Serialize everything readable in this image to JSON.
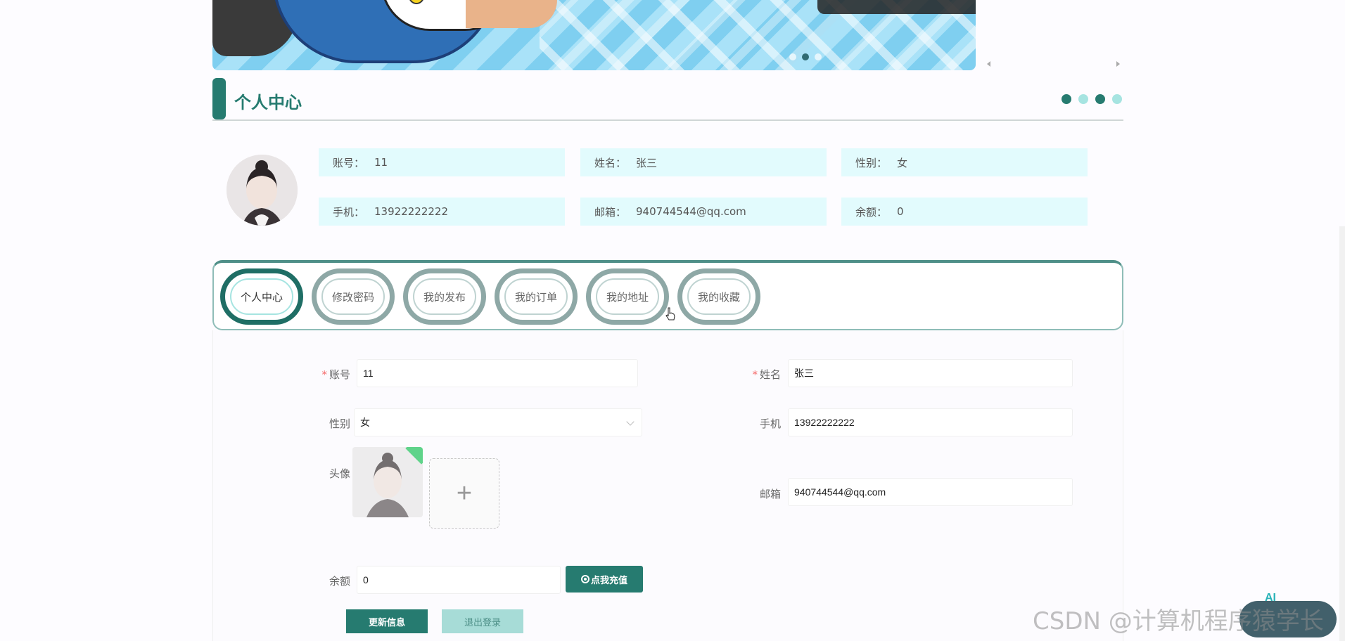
{
  "page": {
    "title": "个人中心",
    "title_dots": [
      "#267b70",
      "#a6e4e1",
      "#267b70",
      "#a6e4e1"
    ]
  },
  "banner": {
    "dots": [
      false,
      true,
      false
    ]
  },
  "profile": {
    "fields": [
      {
        "label": "账号：",
        "value": "11"
      },
      {
        "label": "姓名：",
        "value": "张三"
      },
      {
        "label": "性别：",
        "value": "女"
      },
      {
        "label": "手机：",
        "value": "13922222222"
      },
      {
        "label": "邮箱：",
        "value": "940744544@qq.com"
      },
      {
        "label": "余额：",
        "value": "0"
      }
    ]
  },
  "tabs": [
    {
      "label": "个人中心",
      "active": true
    },
    {
      "label": "修改密码",
      "active": false
    },
    {
      "label": "我的发布",
      "active": false
    },
    {
      "label": "我的订单",
      "active": false
    },
    {
      "label": "我的地址",
      "active": false
    },
    {
      "label": "我的收藏",
      "active": false
    }
  ],
  "form": {
    "account": {
      "label": "账号",
      "value": "11",
      "required": "*"
    },
    "name": {
      "label": "姓名",
      "value": "张三",
      "required": "*"
    },
    "gender": {
      "label": "性别",
      "value": "女"
    },
    "phone": {
      "label": "手机",
      "value": "13922222222"
    },
    "avatar": {
      "label": "头像",
      "upload_icon": "+"
    },
    "email": {
      "label": "邮箱",
      "value": "940744544@qq.com"
    },
    "balance": {
      "label": "余额",
      "value": "0"
    },
    "recharge_label": "点我充值",
    "update_label": "更新信息",
    "logout_label": "退出登录"
  },
  "watermark": "CSDN @计算机程序猿学长",
  "colors": {
    "accent": "#267b70",
    "info_bg": "#e2fbfd",
    "logout_bg": "#a7dcd7"
  }
}
